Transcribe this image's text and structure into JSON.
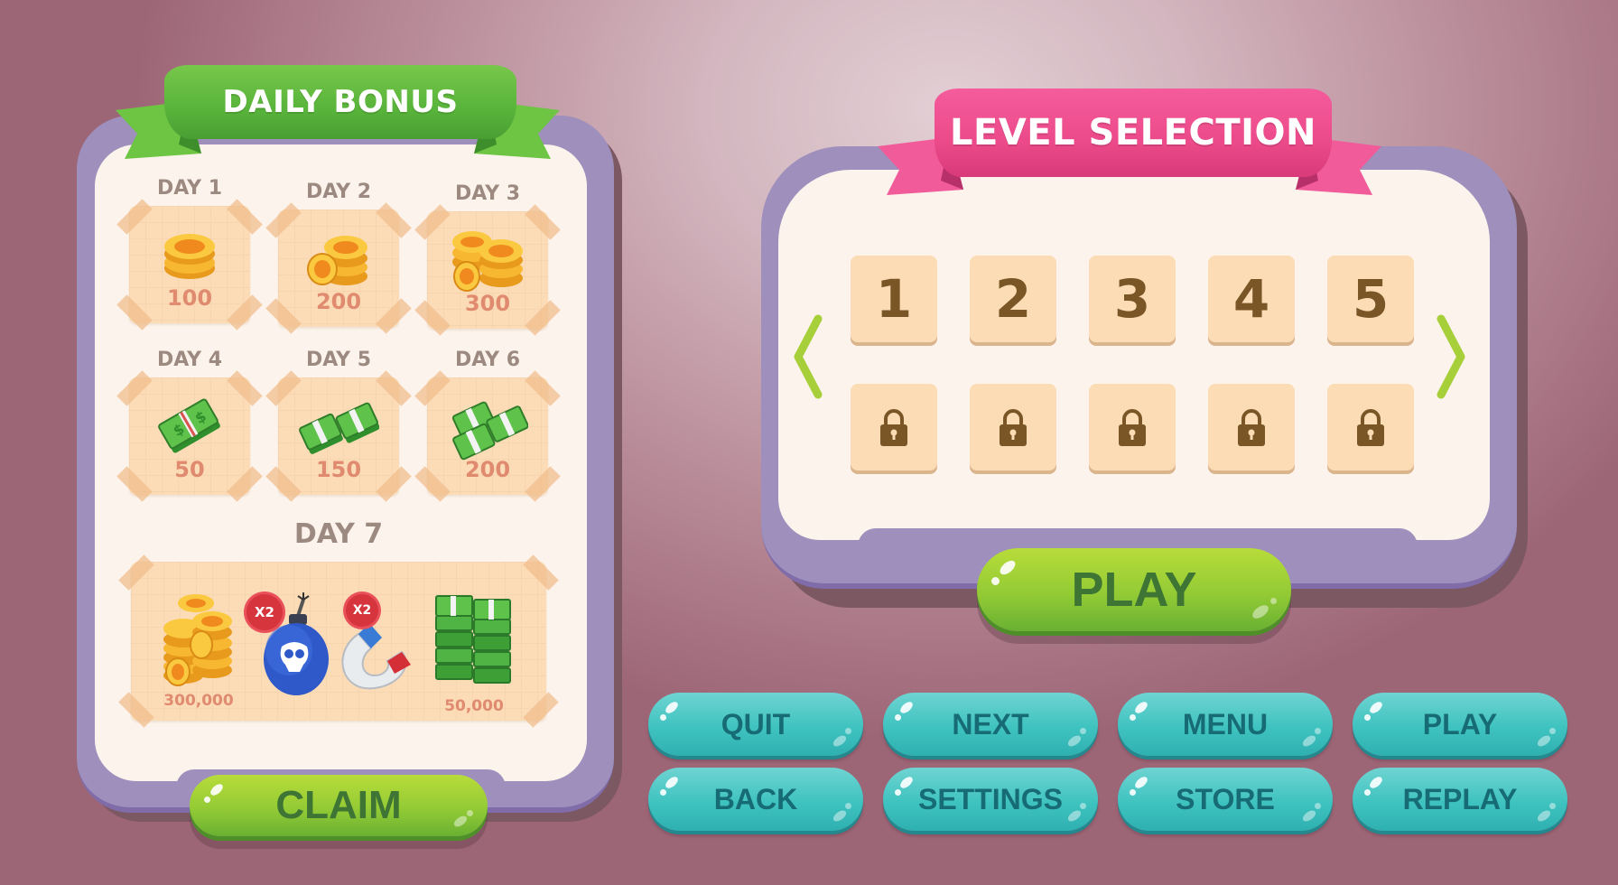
{
  "daily_bonus": {
    "title": "DAILY BONUS",
    "days": [
      {
        "label": "DAY 1",
        "amount": "100",
        "reward_icon": "coin-stack-small-icon"
      },
      {
        "label": "DAY 2",
        "amount": "200",
        "reward_icon": "coin-stack-medium-icon"
      },
      {
        "label": "DAY 3",
        "amount": "300",
        "reward_icon": "coin-stack-large-icon"
      },
      {
        "label": "DAY 4",
        "amount": "50",
        "reward_icon": "cash-bundle-single-icon"
      },
      {
        "label": "DAY 5",
        "amount": "150",
        "reward_icon": "cash-bundle-double-icon"
      },
      {
        "label": "DAY 6",
        "amount": "200",
        "reward_icon": "cash-bundle-triple-icon"
      }
    ],
    "day7": {
      "label": "DAY 7",
      "rewards": [
        {
          "icon": "coin-pile-icon",
          "amount": "300,000"
        },
        {
          "icon": "bomb-icon",
          "badge": "X2"
        },
        {
          "icon": "magnet-icon",
          "badge": "X2"
        },
        {
          "icon": "cash-pile-icon",
          "amount": "50,000"
        }
      ]
    },
    "claim_label": "CLAIM"
  },
  "level_selection": {
    "title": "LEVEL SELECTION",
    "unlocked_levels": [
      "1",
      "2",
      "3",
      "4",
      "5"
    ],
    "locked_count": 5,
    "prev_icon": "chevron-left-icon",
    "next_icon": "chevron-right-icon",
    "play_label": "PLAY"
  },
  "buttons": {
    "quit": "QUIT",
    "next": "NEXT",
    "menu": "MENU",
    "play": "PLAY",
    "back": "BACK",
    "settings": "SETTINGS",
    "store": "STORE",
    "replay": "REPLAY"
  },
  "colors": {
    "ribbon_green": "#5cb83d",
    "ribbon_pink": "#ee4d8c",
    "frame_purple": "#9e8fbc",
    "panel_cream": "#fcf4ec",
    "tile_peach": "#fbdcb5",
    "level_number_brown": "#7a5526",
    "amount_salmon": "#e08a6f",
    "button_green": "#93cb35",
    "button_green_text": "#3e7534",
    "button_teal": "#3fc3c0",
    "button_teal_text": "#176b74",
    "arrow_green": "#a6cf3a"
  }
}
